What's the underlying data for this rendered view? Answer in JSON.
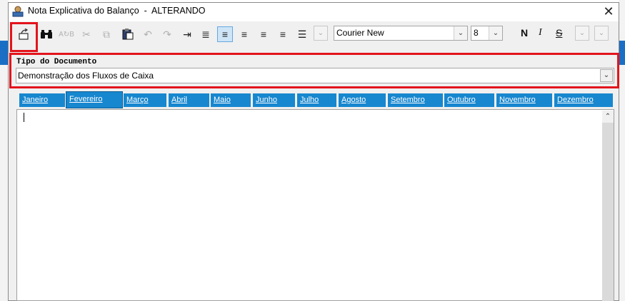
{
  "window": {
    "title": "Nota Explicativa do Balanço  -  ALTERANDO",
    "close_symbol": "✕"
  },
  "toolbar": {
    "buttons": [
      {
        "name": "exit-icon",
        "glyph": "⏏"
      },
      {
        "name": "find-icon",
        "glyph": "🔭"
      },
      {
        "name": "replace-icon",
        "glyph": "ᴬᵦ"
      },
      {
        "name": "cut-icon",
        "glyph": "✂"
      },
      {
        "name": "copy-icon",
        "glyph": "⧉"
      },
      {
        "name": "paste-icon",
        "glyph": "📋"
      },
      {
        "name": "undo-icon",
        "glyph": "↶"
      },
      {
        "name": "redo-icon",
        "glyph": "↷"
      },
      {
        "name": "indent-icon",
        "glyph": "⇥"
      },
      {
        "name": "justify-icon",
        "glyph": "≣"
      },
      {
        "name": "align-left-icon",
        "glyph": "≡"
      },
      {
        "name": "align-center-icon",
        "glyph": "≡"
      },
      {
        "name": "align-right-icon",
        "glyph": "≡"
      },
      {
        "name": "align-justify-icon",
        "glyph": "≡"
      },
      {
        "name": "bullets-icon",
        "glyph": "☰"
      }
    ],
    "font_name": "Courier New",
    "font_size": "8",
    "bold_label": "N",
    "italic_label": "I",
    "strike_label": "S",
    "dropdown_glyph": "⌄"
  },
  "document": {
    "label": "Tipo do Documento",
    "selected": "Demonstração dos Fluxos de Caixa"
  },
  "tabs": [
    {
      "label": "Janeiro"
    },
    {
      "label": "Fevereiro"
    },
    {
      "label": "Março"
    },
    {
      "label": "Abril"
    },
    {
      "label": "Maio"
    },
    {
      "label": "Junho"
    },
    {
      "label": "Julho"
    },
    {
      "label": "Agosto"
    },
    {
      "label": "Setembro"
    },
    {
      "label": "Outubro"
    },
    {
      "label": "Novembro"
    },
    {
      "label": "Dezembro"
    }
  ],
  "active_tab": "Fevereiro",
  "colors": {
    "tab_blue": "#1787cf",
    "highlight_red": "#e3141c"
  },
  "editor": {
    "content": "",
    "scroll_up_glyph": "⌃"
  }
}
